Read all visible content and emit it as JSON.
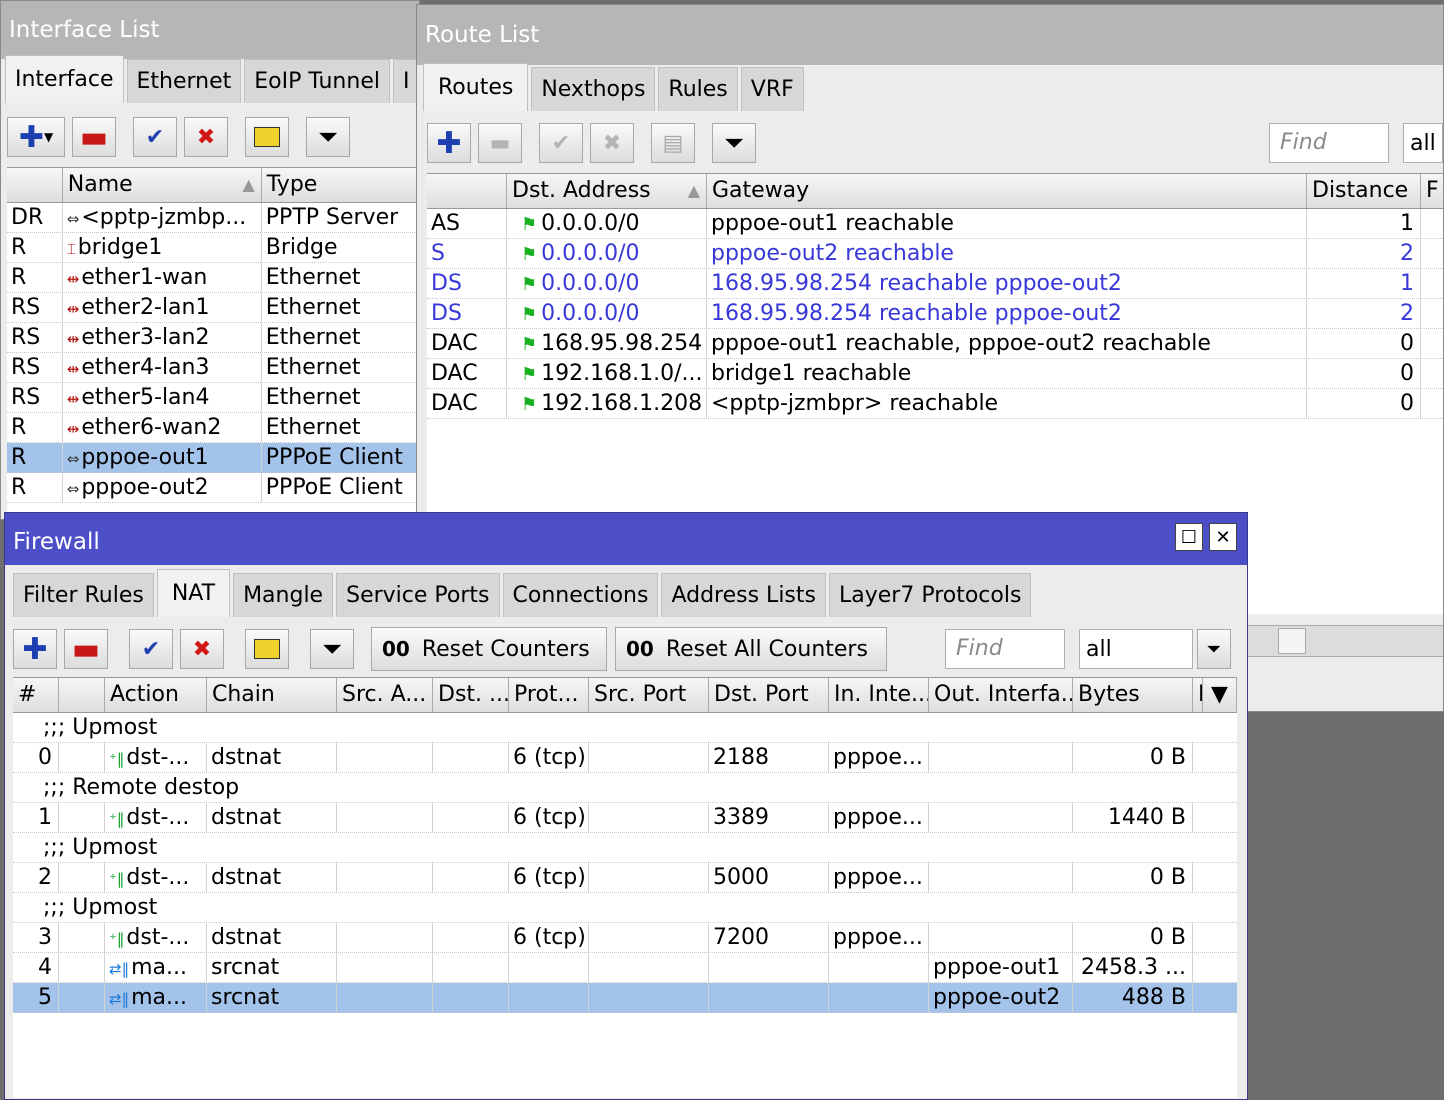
{
  "interface_list": {
    "title": "Interface List",
    "tabs": [
      "Interface",
      "Ethernet",
      "EoIP Tunnel",
      "I"
    ],
    "columns": [
      "",
      "Name",
      "Type"
    ],
    "rows": [
      {
        "flags": "DR",
        "icon": "pptp-server-icon",
        "name": "<pptp-jzmbp...",
        "type": "PPTP Server"
      },
      {
        "flags": "R",
        "icon": "bridge-icon",
        "name": "bridge1",
        "type": "Bridge"
      },
      {
        "flags": "R",
        "icon": "ethernet-icon",
        "name": "ether1-wan",
        "type": "Ethernet"
      },
      {
        "flags": "RS",
        "icon": "ethernet-icon",
        "name": "ether2-lan1",
        "type": "Ethernet"
      },
      {
        "flags": "RS",
        "icon": "ethernet-icon",
        "name": "ether3-lan2",
        "type": "Ethernet"
      },
      {
        "flags": "RS",
        "icon": "ethernet-icon",
        "name": "ether4-lan3",
        "type": "Ethernet"
      },
      {
        "flags": "RS",
        "icon": "ethernet-icon",
        "name": "ether5-lan4",
        "type": "Ethernet"
      },
      {
        "flags": "R",
        "icon": "ethernet-icon",
        "name": "ether6-wan2",
        "type": "Ethernet"
      },
      {
        "flags": "R",
        "icon": "pppoe-icon",
        "name": "pppoe-out1",
        "type": "PPPoE Client",
        "selected": true
      },
      {
        "flags": "R",
        "icon": "pppoe-icon",
        "name": "pppoe-out2",
        "type": "PPPoE Client"
      }
    ]
  },
  "route_list": {
    "title": "Route List",
    "tabs": [
      "Routes",
      "Nexthops",
      "Rules",
      "VRF"
    ],
    "find_placeholder": "Find",
    "filter_value": "all",
    "columns": [
      "",
      "Dst. Address",
      "Gateway",
      "Distance",
      "F"
    ],
    "rows": [
      {
        "flags": "AS",
        "dst": "0.0.0.0/0",
        "gateway": "pppoe-out1 reachable",
        "distance": "1",
        "blue": false
      },
      {
        "flags": "S",
        "dst": "0.0.0.0/0",
        "gateway": "pppoe-out2 reachable",
        "distance": "2",
        "blue": true
      },
      {
        "flags": "DS",
        "dst": "0.0.0.0/0",
        "gateway": "168.95.98.254 reachable pppoe-out2",
        "distance": "1",
        "blue": true
      },
      {
        "flags": "DS",
        "dst": "0.0.0.0/0",
        "gateway": "168.95.98.254 reachable pppoe-out2",
        "distance": "2",
        "blue": true
      },
      {
        "flags": "DAC",
        "dst": "168.95.98.254",
        "gateway": "pppoe-out1 reachable, pppoe-out2 reachable",
        "distance": "0",
        "blue": false
      },
      {
        "flags": "DAC",
        "dst": "192.168.1.0/...",
        "gateway": "bridge1 reachable",
        "distance": "0",
        "blue": false
      },
      {
        "flags": "DAC",
        "dst": "192.168.1.208",
        "gateway": "<pptp-jzmbpr> reachable",
        "distance": "0",
        "blue": false
      }
    ]
  },
  "firewall": {
    "title": "Firewall",
    "tabs": [
      "Filter Rules",
      "NAT",
      "Mangle",
      "Service Ports",
      "Connections",
      "Address Lists",
      "Layer7 Protocols"
    ],
    "reset_counters": "Reset Counters",
    "reset_all_counters": "Reset All Counters",
    "counter_icon": "00",
    "find_placeholder": "Find",
    "filter_value": "all",
    "columns": [
      "#",
      "",
      "Action",
      "Chain",
      "Src. A...",
      "Dst. ...",
      "Prot...",
      "Src. Port",
      "Dst. Port",
      "In. Inte...",
      "Out. Interfa...",
      "Bytes",
      "I"
    ],
    "entries": [
      {
        "comment": ";;; Upmost"
      },
      {
        "num": "0",
        "action": "dst-...",
        "chain": "dstnat",
        "protocol": "6 (tcp)",
        "dst_port": "2188",
        "in_iface": "pppoe...",
        "out_iface": "",
        "bytes": "0 B",
        "kind": "dstnat"
      },
      {
        "comment": ";;; Remote destop"
      },
      {
        "num": "1",
        "action": "dst-...",
        "chain": "dstnat",
        "protocol": "6 (tcp)",
        "dst_port": "3389",
        "in_iface": "pppoe...",
        "out_iface": "",
        "bytes": "1440 B",
        "kind": "dstnat"
      },
      {
        "comment": ";;; Upmost"
      },
      {
        "num": "2",
        "action": "dst-...",
        "chain": "dstnat",
        "protocol": "6 (tcp)",
        "dst_port": "5000",
        "in_iface": "pppoe...",
        "out_iface": "",
        "bytes": "0 B",
        "kind": "dstnat"
      },
      {
        "comment": ";;; Upmost"
      },
      {
        "num": "3",
        "action": "dst-...",
        "chain": "dstnat",
        "protocol": "6 (tcp)",
        "dst_port": "7200",
        "in_iface": "pppoe...",
        "out_iface": "",
        "bytes": "0 B",
        "kind": "dstnat"
      },
      {
        "num": "4",
        "action": "ma...",
        "chain": "srcnat",
        "protocol": "",
        "dst_port": "",
        "in_iface": "",
        "out_iface": "pppoe-out1",
        "bytes": "2458.3 ...",
        "kind": "masquerade"
      },
      {
        "num": "5",
        "action": "ma...",
        "chain": "srcnat",
        "protocol": "",
        "dst_port": "",
        "in_iface": "",
        "out_iface": "pppoe-out2",
        "bytes": "488 B",
        "kind": "masquerade",
        "selected": true
      }
    ]
  },
  "colors": {
    "accent": "#4d4fc9",
    "selected_row": "#a4c3ea",
    "disabled_route": "#3838d8"
  }
}
